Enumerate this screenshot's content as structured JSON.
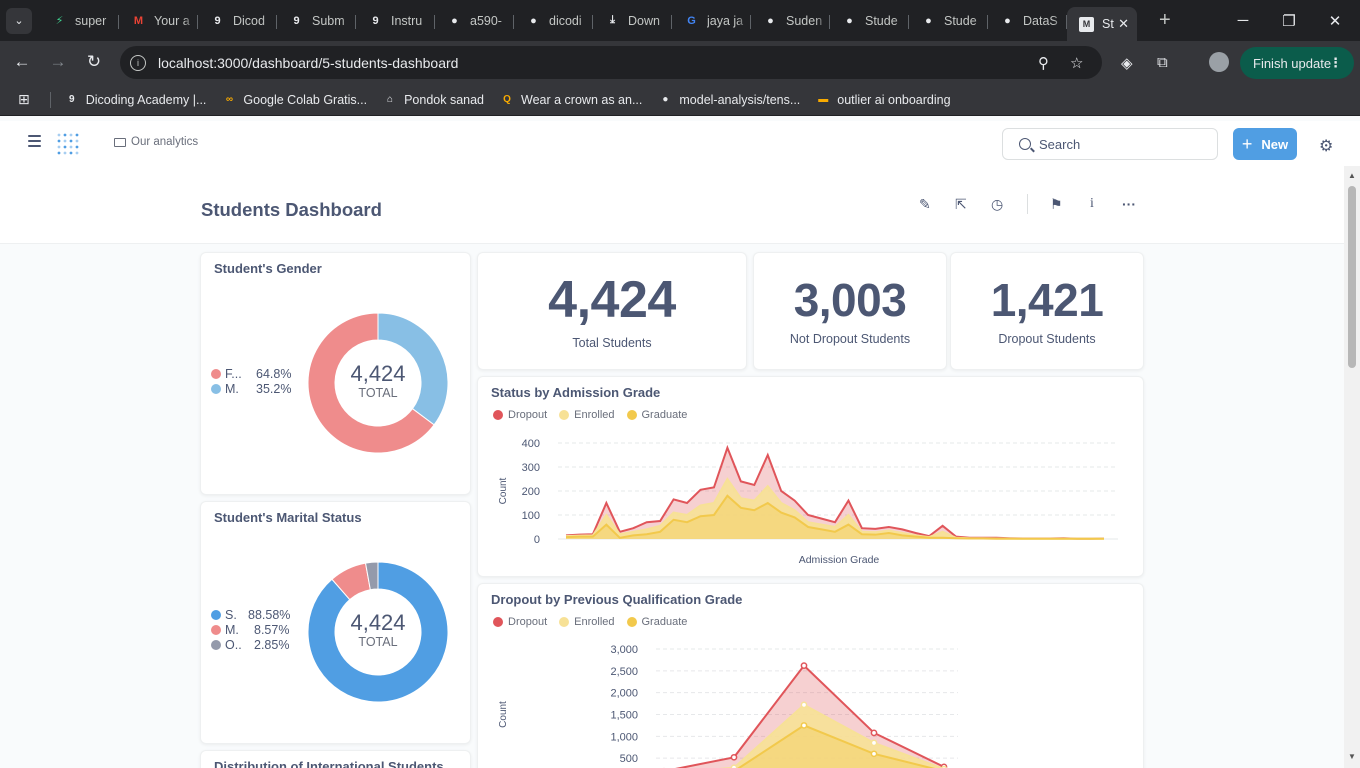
{
  "browser": {
    "tabs": [
      {
        "title": "super",
        "icon": "supabase-icon",
        "color": "#3ecf8e",
        "glyph": "⚡"
      },
      {
        "title": "Your a",
        "icon": "gmail-icon",
        "color": "#ea4335",
        "glyph": "M"
      },
      {
        "title": "Dicod",
        "icon": "dicoding-icon",
        "color": "#e8eaed",
        "glyph": "9"
      },
      {
        "title": "Subm",
        "icon": "dicoding-icon",
        "color": "#e8eaed",
        "glyph": "9"
      },
      {
        "title": "Instru",
        "icon": "dicoding-icon",
        "color": "#e8eaed",
        "glyph": "9"
      },
      {
        "title": "a590-",
        "icon": "github-icon",
        "color": "#e8eaed",
        "glyph": "●"
      },
      {
        "title": "dicodi",
        "icon": "github-icon",
        "color": "#e8eaed",
        "glyph": "●"
      },
      {
        "title": "Down",
        "icon": "download-icon",
        "color": "#e8eaed",
        "glyph": "⤓"
      },
      {
        "title": "jaya ja",
        "icon": "google-icon",
        "color": "#4285f4",
        "glyph": "G"
      },
      {
        "title": "Suden",
        "icon": "github-icon",
        "color": "#e8eaed",
        "glyph": "●"
      },
      {
        "title": "Stude",
        "icon": "github-icon",
        "color": "#e8eaed",
        "glyph": "●"
      },
      {
        "title": "Stude",
        "icon": "github-icon",
        "color": "#e8eaed",
        "glyph": "●"
      },
      {
        "title": "DataS",
        "icon": "github-icon",
        "color": "#e8eaed",
        "glyph": "●"
      }
    ],
    "active_tab": {
      "title": "St",
      "icon": "metabase-icon"
    },
    "url": "localhost:3000/dashboard/5-students-dashboard",
    "finish_update": "Finish update",
    "bookmarks": [
      {
        "label": "Dicoding Academy |...",
        "icon": "dicoding-icon",
        "color": "#e8eaed",
        "glyph": "9"
      },
      {
        "label": "Google Colab Gratis...",
        "icon": "colab-icon",
        "color": "#f9ab00",
        "glyph": "∞"
      },
      {
        "label": "Pondok sanad",
        "icon": "pondok-icon",
        "color": "#e8eaed",
        "glyph": "⌂"
      },
      {
        "label": "Wear a crown as an...",
        "icon": "crown-icon",
        "color": "#f9ab00",
        "glyph": "Q"
      },
      {
        "label": "model-analysis/tens...",
        "icon": "github-icon",
        "color": "#e8eaed",
        "glyph": "●"
      },
      {
        "label": "outlier ai onboarding",
        "icon": "folder-bookmark-icon",
        "color": "#f9ab00",
        "glyph": "▬"
      }
    ]
  },
  "app": {
    "breadcrumb": "Our analytics",
    "search_placeholder": "Search",
    "new_label": "New",
    "dashboard_title": "Students Dashboard"
  },
  "cards": {
    "gender": {
      "title": "Student's Gender",
      "total": "4,424",
      "total_label": "TOTAL",
      "items": [
        {
          "label": "F...",
          "pct": "64.8%",
          "value": 64.8,
          "color": "#ef8c8c"
        },
        {
          "label": "M.",
          "pct": "35.2%",
          "value": 35.2,
          "color": "#88bfe5"
        }
      ]
    },
    "marital": {
      "title": "Student's Marital Status",
      "total": "4,424",
      "total_label": "TOTAL",
      "items": [
        {
          "label": "S.",
          "pct": "88.58%",
          "value": 88.58,
          "color": "#509ee3"
        },
        {
          "label": "M.",
          "pct": "8.57%",
          "value": 8.57,
          "color": "#ef8c8c"
        },
        {
          "label": "O..",
          "pct": "2.85%",
          "value": 2.85,
          "color": "#949aab"
        }
      ]
    },
    "international": {
      "title": "Distribution of International Students"
    },
    "kpi_total": {
      "value": "4,424",
      "label": "Total Students"
    },
    "kpi_not_dropout": {
      "value": "3,003",
      "label": "Not Dropout Students"
    },
    "kpi_dropout": {
      "value": "1,421",
      "label": "Dropout Students"
    }
  },
  "chart_data": [
    {
      "type": "area",
      "title": "Status by Admission Grade",
      "xlabel": "Admission Grade",
      "ylabel": "Count",
      "ylim": [
        0,
        400
      ],
      "yticks": [
        "0",
        "100",
        "200",
        "300",
        "400"
      ],
      "legend": [
        "Dropout",
        "Enrolled",
        "Graduate"
      ],
      "colors": {
        "Dropout": "#e0555a",
        "Enrolled": "#f7e196",
        "Graduate": "#f2c94c"
      },
      "series": [
        {
          "name": "Graduate",
          "values": [
            8,
            10,
            10,
            60,
            5,
            15,
            20,
            30,
            80,
            70,
            95,
            100,
            180,
            130,
            120,
            150,
            110,
            90,
            50,
            40,
            30,
            60,
            20,
            18,
            25,
            15,
            10,
            5,
            5,
            3,
            2,
            2,
            1,
            1,
            1,
            1,
            1,
            1,
            1,
            1,
            1
          ]
        },
        {
          "name": "Enrolled",
          "values": [
            12,
            14,
            15,
            100,
            20,
            30,
            40,
            55,
            110,
            100,
            140,
            150,
            250,
            170,
            160,
            220,
            150,
            120,
            70,
            60,
            50,
            100,
            30,
            28,
            35,
            25,
            15,
            8,
            30,
            5,
            3,
            3,
            2,
            2,
            1,
            1,
            1,
            1,
            1,
            1,
            1
          ]
        },
        {
          "name": "Dropout",
          "values": [
            15,
            18,
            20,
            150,
            30,
            45,
            70,
            75,
            165,
            150,
            205,
            215,
            380,
            240,
            225,
            350,
            200,
            160,
            100,
            85,
            70,
            160,
            45,
            42,
            50,
            40,
            25,
            12,
            55,
            10,
            5,
            5,
            5,
            3,
            2,
            2,
            2,
            3,
            1,
            1,
            2
          ]
        }
      ]
    },
    {
      "type": "area",
      "title": "Dropout by Previous Qualification Grade",
      "xlabel": "",
      "ylabel": "Count",
      "ylim": [
        0,
        3000
      ],
      "yticks": [
        "500",
        "1,000",
        "1,500",
        "2,000",
        "2,500",
        "3,000"
      ],
      "legend": [
        "Dropout",
        "Enrolled",
        "Graduate"
      ],
      "colors": {
        "Dropout": "#e0555a",
        "Enrolled": "#f7e196",
        "Graduate": "#f2c94c"
      },
      "series": [
        {
          "name": "Graduate",
          "values": [
            100,
            200,
            1250,
            600,
            200
          ]
        },
        {
          "name": "Enrolled",
          "values": [
            150,
            280,
            1720,
            850,
            250
          ]
        },
        {
          "name": "Dropout",
          "values": [
            200,
            520,
            2620,
            1080,
            300
          ]
        }
      ]
    }
  ]
}
